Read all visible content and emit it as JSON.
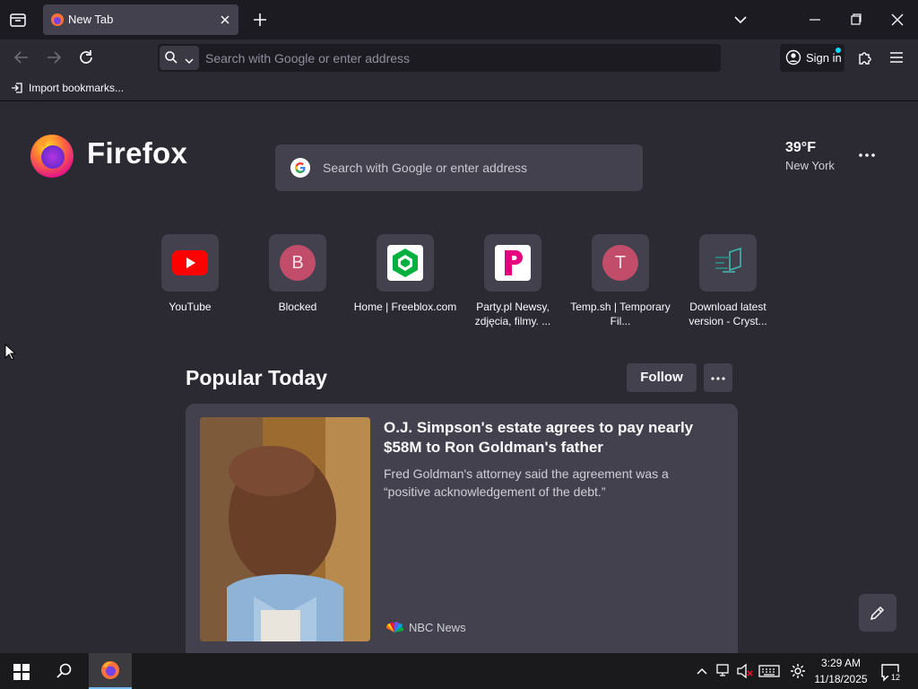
{
  "browser": {
    "tab": {
      "title": "New Tab"
    },
    "urlbar": {
      "placeholder": "Search with Google or enter address"
    },
    "signin_label": "Sign in",
    "bookmarks": {
      "import_label": "Import bookmarks..."
    }
  },
  "newtab": {
    "brand": "Firefox",
    "search": {
      "placeholder": "Search with Google or enter address"
    },
    "weather": {
      "temperature": "39°F",
      "location": "New York"
    },
    "shortcuts": [
      {
        "label": "YouTube",
        "icon": "youtube-icon"
      },
      {
        "label": "Blocked",
        "letter": "B"
      },
      {
        "label": "Home | Freeblox.com",
        "icon": "freeblox-icon"
      },
      {
        "label": "Party.pl Newsy, zdjęcia, filmy. ...",
        "icon": "party-pl-icon"
      },
      {
        "label": "Temp.sh | Temporary Fil...",
        "letter": "T"
      },
      {
        "label": "Download latest version - Cryst...",
        "icon": "crystal-icon"
      }
    ],
    "popular": {
      "title": "Popular Today",
      "follow_label": "Follow",
      "story": {
        "headline": "O.J. Simpson's estate agrees to pay nearly $58M to Ron Goldman's father",
        "excerpt": "Fred Goldman's attorney said the agreement was a “positive acknowledgement of the debt.”",
        "source": "NBC News"
      }
    }
  },
  "taskbar": {
    "time": "3:29 AM",
    "date": "11/18/2025",
    "notification_count": "12"
  },
  "colors": {
    "accent": "#00ddff",
    "letter_tile": "#c24d6a",
    "youtube": "#ff0000",
    "freeblox": "#00b140",
    "party": "#e5007e"
  }
}
